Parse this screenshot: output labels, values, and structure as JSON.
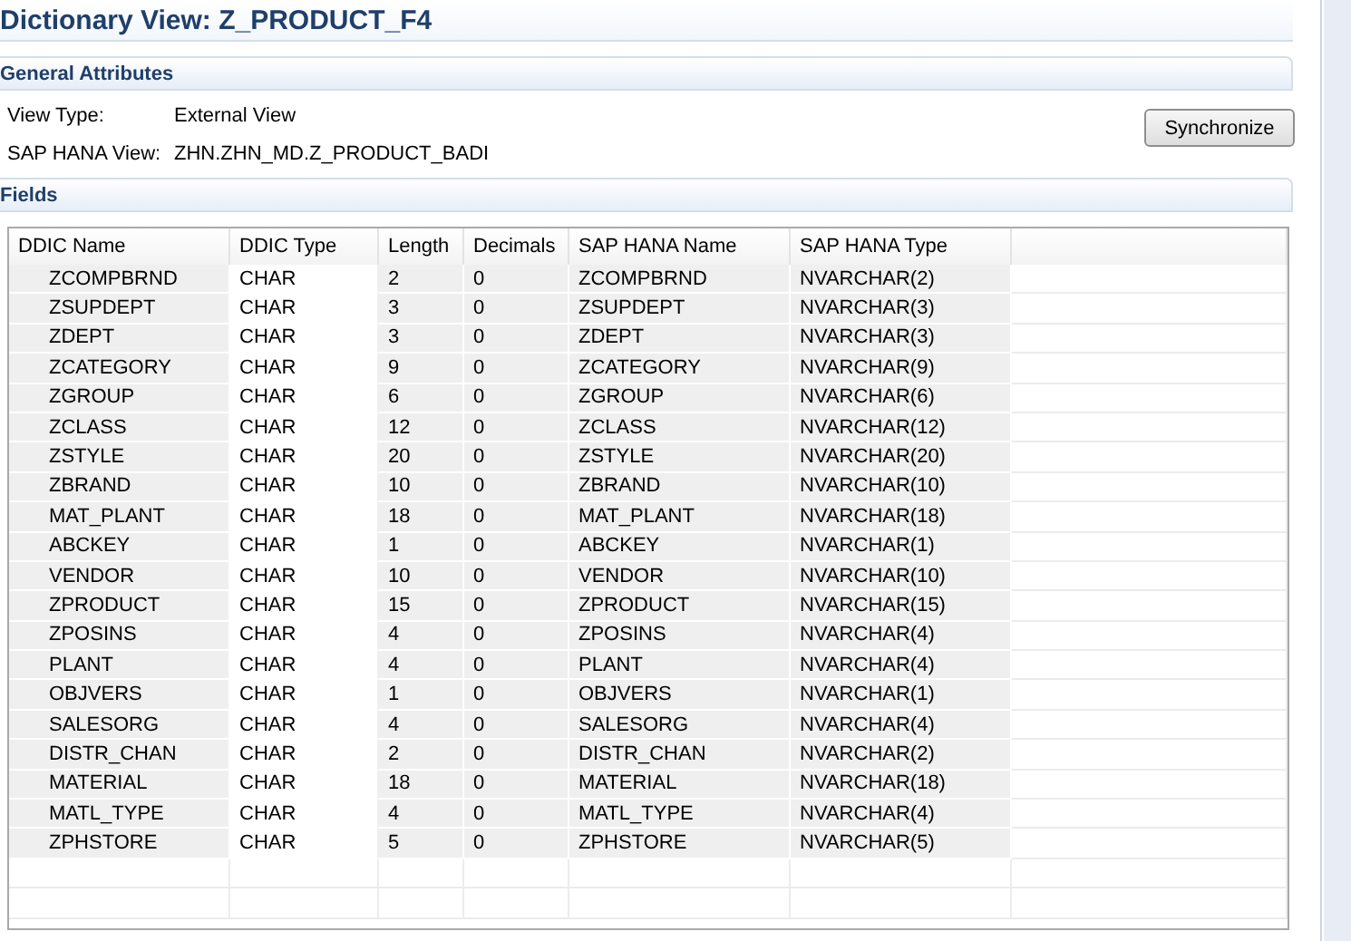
{
  "title": "Dictionary View: Z_PRODUCT_F4",
  "general_attributes": {
    "heading": "General Attributes",
    "attributes": [
      {
        "label": "View Type:",
        "value": "External View"
      },
      {
        "label": "SAP HANA View:",
        "value": "ZHN.ZHN_MD.Z_PRODUCT_BADI"
      }
    ],
    "button": "Synchronize"
  },
  "fields": {
    "heading": "Fields",
    "columns": [
      {
        "label": "DDIC Name",
        "editable": false
      },
      {
        "label": "DDIC Type",
        "editable": true
      },
      {
        "label": "Length",
        "editable": false
      },
      {
        "label": "Decimals",
        "editable": false
      },
      {
        "label": "SAP HANA Name",
        "editable": false
      },
      {
        "label": "SAP HANA Type",
        "editable": false
      }
    ],
    "rows": [
      [
        "ZCOMPBRND",
        "CHAR",
        "2",
        "0",
        "ZCOMPBRND",
        "NVARCHAR(2)"
      ],
      [
        "ZSUPDEPT",
        "CHAR",
        "3",
        "0",
        "ZSUPDEPT",
        "NVARCHAR(3)"
      ],
      [
        "ZDEPT",
        "CHAR",
        "3",
        "0",
        "ZDEPT",
        "NVARCHAR(3)"
      ],
      [
        "ZCATEGORY",
        "CHAR",
        "9",
        "0",
        "ZCATEGORY",
        "NVARCHAR(9)"
      ],
      [
        "ZGROUP",
        "CHAR",
        "6",
        "0",
        "ZGROUP",
        "NVARCHAR(6)"
      ],
      [
        "ZCLASS",
        "CHAR",
        "12",
        "0",
        "ZCLASS",
        "NVARCHAR(12)"
      ],
      [
        "ZSTYLE",
        "CHAR",
        "20",
        "0",
        "ZSTYLE",
        "NVARCHAR(20)"
      ],
      [
        "ZBRAND",
        "CHAR",
        "10",
        "0",
        "ZBRAND",
        "NVARCHAR(10)"
      ],
      [
        "MAT_PLANT",
        "CHAR",
        "18",
        "0",
        "MAT_PLANT",
        "NVARCHAR(18)"
      ],
      [
        "ABCKEY",
        "CHAR",
        "1",
        "0",
        "ABCKEY",
        "NVARCHAR(1)"
      ],
      [
        "VENDOR",
        "CHAR",
        "10",
        "0",
        "VENDOR",
        "NVARCHAR(10)"
      ],
      [
        "ZPRODUCT",
        "CHAR",
        "15",
        "0",
        "ZPRODUCT",
        "NVARCHAR(15)"
      ],
      [
        "ZPOSINS",
        "CHAR",
        "4",
        "0",
        "ZPOSINS",
        "NVARCHAR(4)"
      ],
      [
        "PLANT",
        "CHAR",
        "4",
        "0",
        "PLANT",
        "NVARCHAR(4)"
      ],
      [
        "OBJVERS",
        "CHAR",
        "1",
        "0",
        "OBJVERS",
        "NVARCHAR(1)"
      ],
      [
        "SALESORG",
        "CHAR",
        "4",
        "0",
        "SALESORG",
        "NVARCHAR(4)"
      ],
      [
        "DISTR_CHAN",
        "CHAR",
        "2",
        "0",
        "DISTR_CHAN",
        "NVARCHAR(2)"
      ],
      [
        "MATERIAL",
        "CHAR",
        "18",
        "0",
        "MATERIAL",
        "NVARCHAR(18)"
      ],
      [
        "MATL_TYPE",
        "CHAR",
        "4",
        "0",
        "MATL_TYPE",
        "NVARCHAR(4)"
      ],
      [
        "ZPHSTORE",
        "CHAR",
        "5",
        "0",
        "ZPHSTORE",
        "NVARCHAR(5)"
      ]
    ]
  }
}
